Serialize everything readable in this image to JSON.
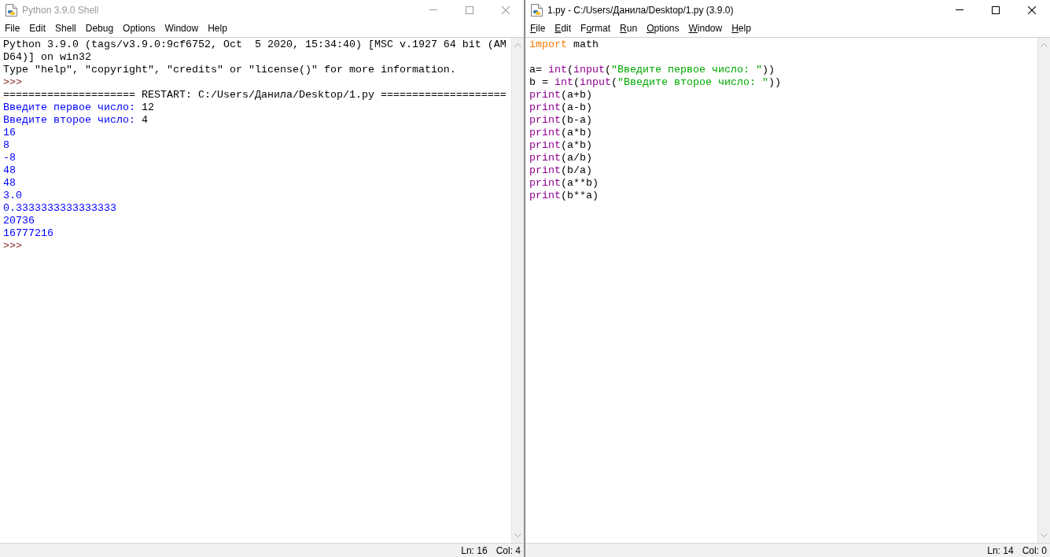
{
  "shell_window": {
    "title": "Python 3.9.0 Shell",
    "active": false,
    "menu": [
      {
        "label": "File"
      },
      {
        "label": "Edit"
      },
      {
        "label": "Shell"
      },
      {
        "label": "Debug"
      },
      {
        "label": "Options"
      },
      {
        "label": "Window"
      },
      {
        "label": "Help"
      }
    ],
    "lines": [
      {
        "kind": "text",
        "segments": [
          {
            "kind": "plain",
            "text": "Python 3.9.0 (tags/v3.9.0:9cf6752, Oct  5 2020, 15:34:40) [MSC v.1927 64 bit (AM"
          }
        ]
      },
      {
        "kind": "text",
        "segments": [
          {
            "kind": "plain",
            "text": "D64)] on win32"
          }
        ]
      },
      {
        "kind": "text",
        "segments": [
          {
            "kind": "plain",
            "text": "Type \"help\", \"copyright\", \"credits\" or \"license()\" for more information."
          }
        ]
      },
      {
        "kind": "text",
        "segments": [
          {
            "kind": "prompt",
            "text": ">>>"
          }
        ]
      },
      {
        "kind": "text",
        "segments": [
          {
            "kind": "plain",
            "text": "===================== RESTART: C:/Users/Данила/Desktop/1.py ===================="
          }
        ]
      },
      {
        "kind": "text",
        "segments": [
          {
            "kind": "stdout",
            "text": "Введите первое число: "
          },
          {
            "kind": "stdin",
            "text": "12"
          }
        ]
      },
      {
        "kind": "text",
        "segments": [
          {
            "kind": "stdout",
            "text": "Введите второе число: "
          },
          {
            "kind": "stdin",
            "text": "4"
          }
        ]
      },
      {
        "kind": "text",
        "segments": [
          {
            "kind": "stdout",
            "text": "16"
          }
        ]
      },
      {
        "kind": "text",
        "segments": [
          {
            "kind": "stdout",
            "text": "8"
          }
        ]
      },
      {
        "kind": "text",
        "segments": [
          {
            "kind": "stdout",
            "text": "-8"
          }
        ]
      },
      {
        "kind": "text",
        "segments": [
          {
            "kind": "stdout",
            "text": "48"
          }
        ]
      },
      {
        "kind": "text",
        "segments": [
          {
            "kind": "stdout",
            "text": "48"
          }
        ]
      },
      {
        "kind": "text",
        "segments": [
          {
            "kind": "stdout",
            "text": "3.0"
          }
        ]
      },
      {
        "kind": "text",
        "segments": [
          {
            "kind": "stdout",
            "text": "0.3333333333333333"
          }
        ]
      },
      {
        "kind": "text",
        "segments": [
          {
            "kind": "stdout",
            "text": "20736"
          }
        ]
      },
      {
        "kind": "text",
        "segments": [
          {
            "kind": "stdout",
            "text": "16777216"
          }
        ]
      },
      {
        "kind": "text",
        "segments": [
          {
            "kind": "prompt",
            "text": ">>>"
          }
        ]
      }
    ],
    "status_bar": {
      "line": "Ln: 16",
      "column": "Col: 4"
    }
  },
  "editor_window": {
    "title": "1.py - C:/Users/Данила/Desktop/1.py (3.9.0)",
    "active": true,
    "menu": [
      {
        "parts": [
          {
            "text": "F",
            "underlined": true
          },
          {
            "text": "ile",
            "underlined": false
          }
        ]
      },
      {
        "parts": [
          {
            "text": "E",
            "underlined": true
          },
          {
            "text": "dit",
            "underlined": false
          }
        ]
      },
      {
        "parts": [
          {
            "text": "F",
            "underlined": false
          },
          {
            "text": "o",
            "underlined": true
          },
          {
            "text": "rmat",
            "underlined": false
          }
        ]
      },
      {
        "parts": [
          {
            "text": "R",
            "underlined": true
          },
          {
            "text": "un",
            "underlined": false
          }
        ]
      },
      {
        "parts": [
          {
            "text": "O",
            "underlined": true
          },
          {
            "text": "ptions",
            "underlined": false
          }
        ]
      },
      {
        "parts": [
          {
            "text": "W",
            "underlined": true
          },
          {
            "text": "indow",
            "underlined": false
          }
        ]
      },
      {
        "parts": [
          {
            "text": "H",
            "underlined": true
          },
          {
            "text": "elp",
            "underlined": false
          }
        ]
      }
    ],
    "lines": [
      {
        "kind": "text",
        "segments": [
          {
            "kind": "keyword",
            "text": "import"
          },
          {
            "kind": "plain",
            "text": " math"
          }
        ]
      },
      {
        "kind": "blank"
      },
      {
        "kind": "text",
        "segments": [
          {
            "kind": "plain",
            "text": "a= "
          },
          {
            "kind": "builtin",
            "text": "int"
          },
          {
            "kind": "plain",
            "text": "("
          },
          {
            "kind": "builtin",
            "text": "input"
          },
          {
            "kind": "plain",
            "text": "("
          },
          {
            "kind": "string",
            "text": "\"Введите первое число: \""
          },
          {
            "kind": "plain",
            "text": "))"
          }
        ]
      },
      {
        "kind": "text",
        "segments": [
          {
            "kind": "plain",
            "text": "b = "
          },
          {
            "kind": "builtin",
            "text": "int"
          },
          {
            "kind": "plain",
            "text": "("
          },
          {
            "kind": "builtin",
            "text": "input"
          },
          {
            "kind": "plain",
            "text": "("
          },
          {
            "kind": "string",
            "text": "\"Введите второе число: \""
          },
          {
            "kind": "plain",
            "text": "))"
          }
        ]
      },
      {
        "kind": "text",
        "segments": [
          {
            "kind": "builtin",
            "text": "print"
          },
          {
            "kind": "plain",
            "text": "(a+b)"
          }
        ]
      },
      {
        "kind": "text",
        "segments": [
          {
            "kind": "builtin",
            "text": "print"
          },
          {
            "kind": "plain",
            "text": "(a-b)"
          }
        ]
      },
      {
        "kind": "text",
        "segments": [
          {
            "kind": "builtin",
            "text": "print"
          },
          {
            "kind": "plain",
            "text": "(b-a)"
          }
        ]
      },
      {
        "kind": "text",
        "segments": [
          {
            "kind": "builtin",
            "text": "print"
          },
          {
            "kind": "plain",
            "text": "(a*b)"
          }
        ]
      },
      {
        "kind": "text",
        "segments": [
          {
            "kind": "builtin",
            "text": "print"
          },
          {
            "kind": "plain",
            "text": "(a*b)"
          }
        ]
      },
      {
        "kind": "text",
        "segments": [
          {
            "kind": "builtin",
            "text": "print"
          },
          {
            "kind": "plain",
            "text": "(a/b)"
          }
        ]
      },
      {
        "kind": "text",
        "segments": [
          {
            "kind": "builtin",
            "text": "print"
          },
          {
            "kind": "plain",
            "text": "(b/a)"
          }
        ]
      },
      {
        "kind": "text",
        "segments": [
          {
            "kind": "builtin",
            "text": "print"
          },
          {
            "kind": "plain",
            "text": "(a**b)"
          }
        ]
      },
      {
        "kind": "text",
        "segments": [
          {
            "kind": "builtin",
            "text": "print"
          },
          {
            "kind": "plain",
            "text": "(b**a)"
          }
        ]
      }
    ],
    "status_bar": {
      "line": "Ln: 14",
      "column": "Col: 0"
    }
  }
}
